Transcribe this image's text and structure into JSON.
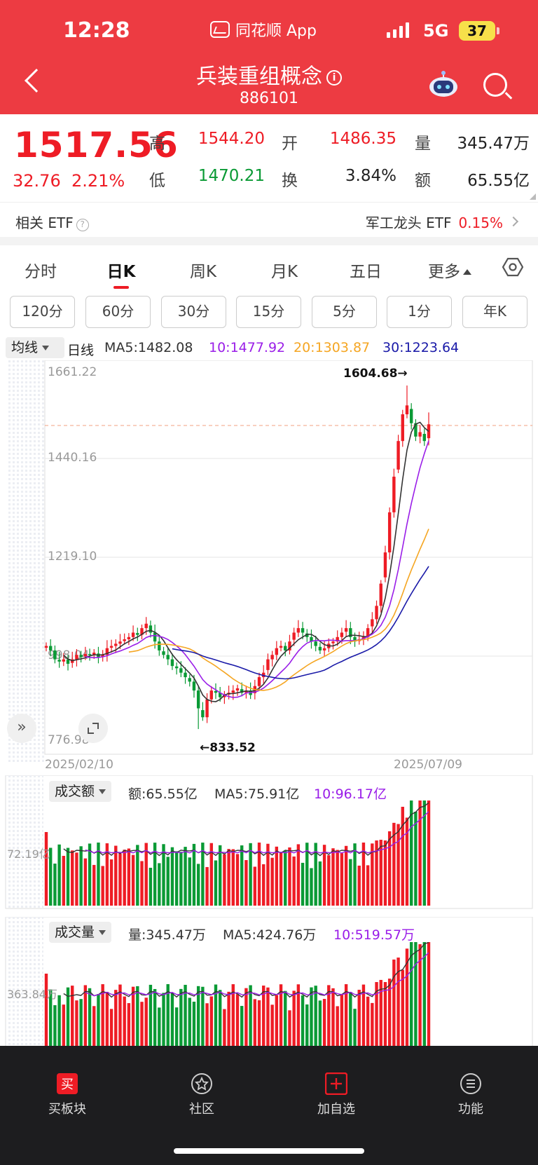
{
  "status_bar": {
    "time": "12:28",
    "app": "同花顺 App",
    "network": "5G",
    "battery": "37"
  },
  "header": {
    "title": "兵装重组概念",
    "code": "886101",
    "info": "i"
  },
  "quote": {
    "price": "1517.56",
    "change": "32.76",
    "change_pct": "2.21%",
    "high_label": "高",
    "high": "1544.20",
    "open_label": "开",
    "open": "1486.35",
    "vol_label": "量",
    "vol": "345.47万",
    "low_label": "低",
    "low": "1470.21",
    "turnover_label": "换",
    "turnover": "3.84%",
    "amount_label": "额",
    "amount": "65.55亿"
  },
  "etf": {
    "left": "相关 ETF",
    "q": "?",
    "right": "军工龙头 ETF",
    "right_pct": "0.15%"
  },
  "tabs": [
    "分时",
    "日K",
    "周K",
    "月K",
    "五日",
    "更多"
  ],
  "periods": [
    "120分",
    "60分",
    "30分",
    "15分",
    "5分",
    "1分",
    "年K"
  ],
  "ma_row": {
    "selector": "均线",
    "kind": "日线",
    "ma5": "MA5:1482.08",
    "ma10": "10:1477.92",
    "ma20": "20:1303.87",
    "ma30": "30:1223.64"
  },
  "colors": {
    "up": "#ee1c25",
    "down": "#0a9a35",
    "ma5": "#333333",
    "ma10": "#9a1ee8",
    "ma20": "#f5a623",
    "ma30": "#1a1aa8",
    "header": "#ed3b42"
  },
  "main_chart": {
    "y_labels": [
      "1661.22",
      "1440.16",
      "1219.10",
      "998.04",
      "776.98"
    ],
    "high_label": "1604.68→",
    "low_label": "←833.52",
    "date_start": "2025/02/10",
    "date_end": "2025/07/09"
  },
  "amount_panel": {
    "selector": "成交额",
    "info": "额:65.55亿",
    "ma5": "MA5:75.91亿",
    "ma10": "10:96.17亿",
    "y_label": "72.19亿"
  },
  "volume_panel": {
    "selector": "成交量",
    "info": "量:345.47万",
    "ma5": "MA5:424.76万",
    "ma10": "10:519.57万",
    "y_label": "363.84万"
  },
  "nav": {
    "buy": "买板块",
    "community": "社区",
    "add": "加自选",
    "func": "功能"
  },
  "expand_icon": "»",
  "chart_data": {
    "type": "candlestick",
    "ylim": [
      776.98,
      1661.22
    ],
    "x_range": [
      "2025/02/10",
      "2025/07/09"
    ],
    "last_close": 1517.56,
    "period_high": 1604.68,
    "period_low": 833.52,
    "ma_last": {
      "MA5": 1482.08,
      "MA10": 1477.92,
      "MA20": 1303.87,
      "MA30": 1223.64
    },
    "closes": [
      1020,
      1010,
      990,
      985,
      990,
      980,
      990,
      1000,
      995,
      1002,
      1000,
      1005,
      995,
      1000,
      1015,
      1020,
      1025,
      1030,
      1035,
      1040,
      1050,
      1045,
      1060,
      1070,
      1050,
      1030,
      1010,
      1000,
      990,
      975,
      970,
      960,
      950,
      940,
      920,
      880,
      860,
      900,
      920,
      915,
      905,
      910,
      915,
      920,
      925,
      915,
      920,
      910,
      930,
      950,
      960,
      990,
      1000,
      1015,
      1020,
      1010,
      1030,
      1050,
      1060,
      1050,
      1040,
      1030,
      1020,
      1010,
      1015,
      1025,
      1030,
      1040,
      1050,
      1060,
      1040,
      1030,
      1035,
      1040,
      1060,
      1080,
      1110,
      1160,
      1230,
      1320,
      1400,
      1480,
      1540,
      1560,
      1520,
      1490,
      1500,
      1480,
      1517.56
    ],
    "amount": {
      "unit": "亿",
      "last": 65.55,
      "MA5": 75.91,
      "MA10": 96.17
    },
    "volume": {
      "unit": "万",
      "last": 345.47,
      "MA5": 424.76,
      "MA10": 519.57
    }
  }
}
